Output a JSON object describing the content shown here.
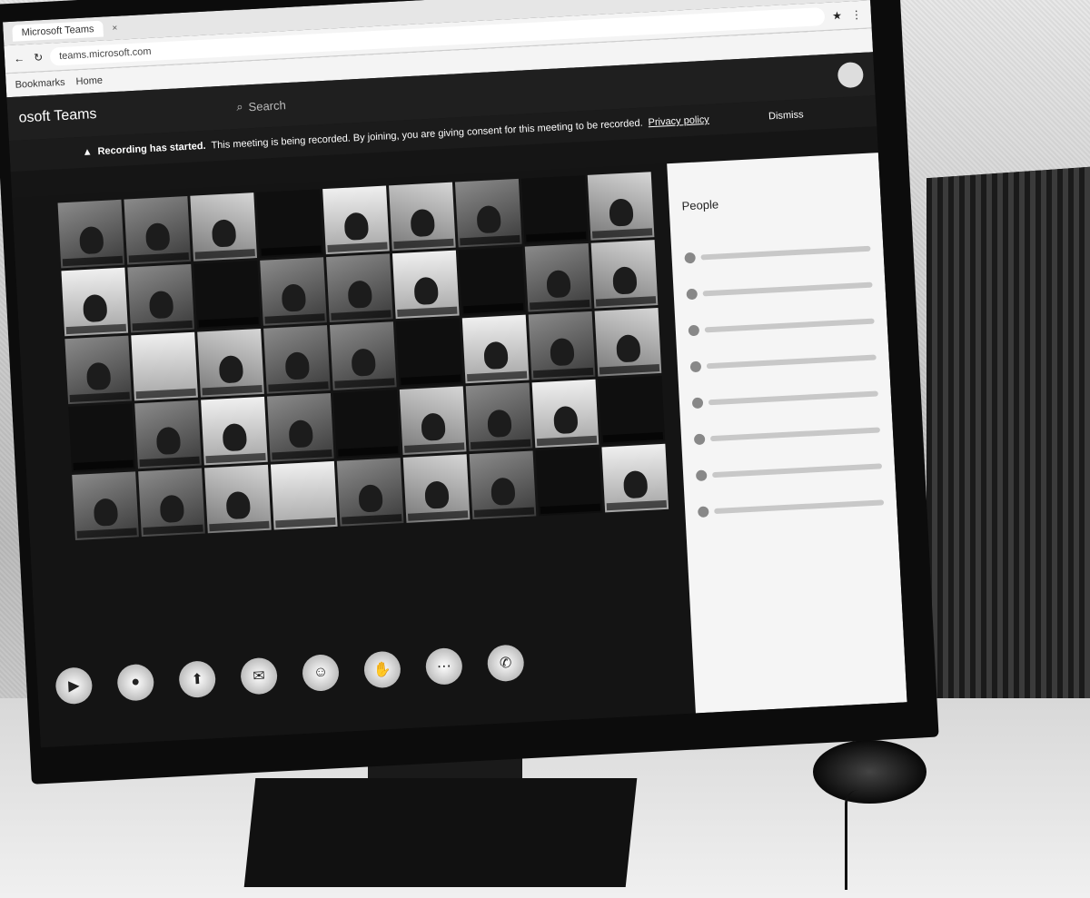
{
  "browser": {
    "tab_label": "Microsoft Teams",
    "tab_close": "×",
    "url": "teams.microsoft.com",
    "bookmark_1": "Bookmarks",
    "bookmark_2": "Home"
  },
  "teams": {
    "title": "osoft Teams",
    "search_label": "Search",
    "avatar_initials": ""
  },
  "banner": {
    "headline": "Recording has started.",
    "message": "This meeting is being recorded. By joining, you are giving consent for this meeting to be recorded.",
    "privacy_link": "Privacy policy",
    "dismiss": "Dismiss"
  },
  "people": {
    "title": "People"
  },
  "controls": [
    {
      "icon": "video-icon",
      "glyph": "▶"
    },
    {
      "icon": "mic-icon",
      "glyph": "●"
    },
    {
      "icon": "share-icon",
      "glyph": "⬆"
    },
    {
      "icon": "chat-icon",
      "glyph": "✉"
    },
    {
      "icon": "people-icon",
      "glyph": "☺"
    },
    {
      "icon": "raise-hand-icon",
      "glyph": "✋"
    },
    {
      "icon": "more-icon",
      "glyph": "⋯"
    },
    {
      "icon": "leave-icon",
      "glyph": "✆"
    }
  ]
}
